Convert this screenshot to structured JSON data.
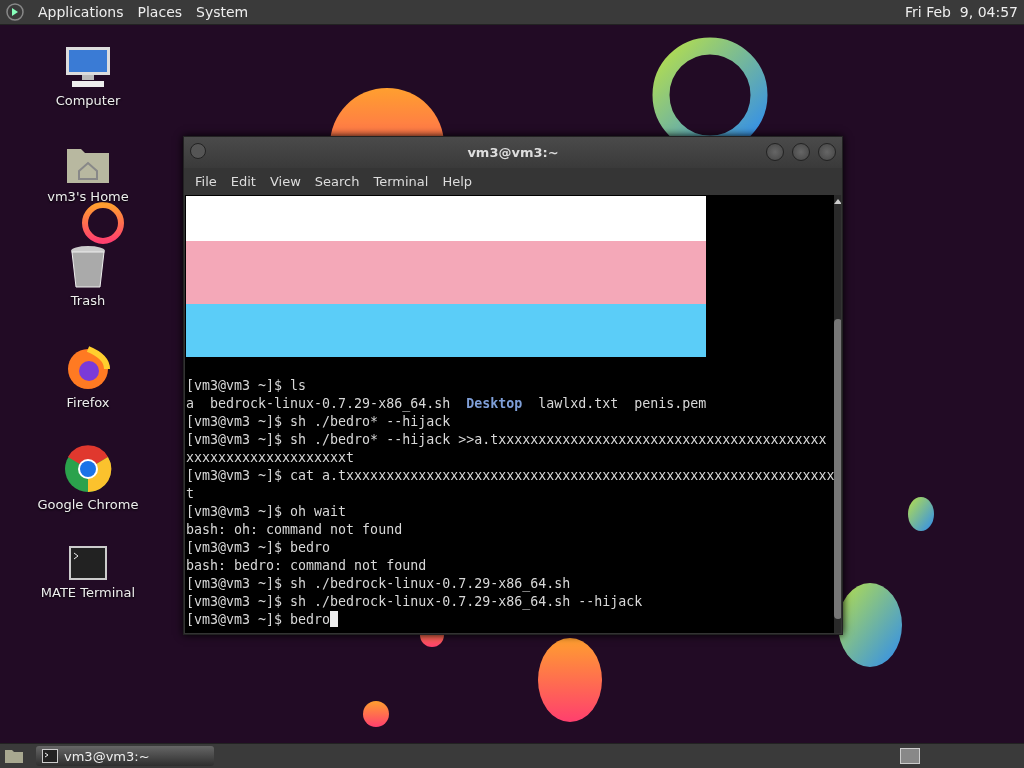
{
  "top_panel": {
    "menus": [
      {
        "label": "Applications"
      },
      {
        "label": "Places"
      },
      {
        "label": "System"
      }
    ],
    "clock": "Fri Feb  9, 04:57"
  },
  "desktop_icons": [
    {
      "label": "Computer",
      "kind": "computer"
    },
    {
      "label": "vm3's Home",
      "kind": "home"
    },
    {
      "label": "Trash",
      "kind": "trash"
    },
    {
      "label": "Firefox",
      "kind": "firefox"
    },
    {
      "label": "Google Chrome",
      "kind": "chrome"
    },
    {
      "label": "MATE Terminal",
      "kind": "terminal"
    }
  ],
  "window": {
    "title": "vm3@vm3:~",
    "menus": [
      {
        "label": "File"
      },
      {
        "label": "Edit"
      },
      {
        "label": "View"
      },
      {
        "label": "Search"
      },
      {
        "label": "Terminal"
      },
      {
        "label": "Help"
      }
    ],
    "lines": [
      "[vm3@vm3 ~]$ ls",
      "a  bedrock-linux-0.7.29-x86_64.sh  **Desktop**  lawlxd.txt  penis.pem",
      "[vm3@vm3 ~]$ sh ./bedro* --hijack",
      "[vm3@vm3 ~]$ sh ./bedro* --hijack >>a.txxxxxxxxxxxxxxxxxxxxxxxxxxxxxxxxxxxxxxxxx",
      "xxxxxxxxxxxxxxxxxxxxt",
      "[vm3@vm3 ~]$ cat a.txxxxxxxxxxxxxxxxxxxxxxxxxxxxxxxxxxxxxxxxxxxxxxxxxxxxxxxxxxxxx",
      "t",
      "[vm3@vm3 ~]$ oh wait",
      "bash: oh: command not found",
      "[vm3@vm3 ~]$ bedro",
      "bash: bedro: command not found",
      "[vm3@vm3 ~]$ sh ./bedrock-linux-0.7.29-x86_64.sh",
      "[vm3@vm3 ~]$ sh ./bedrock-linux-0.7.29-x86_64.sh --hijack",
      "[vm3@vm3 ~]$ bedro"
    ]
  },
  "taskbar": {
    "tasks": [
      {
        "label": "vm3@vm3:~",
        "selected": true
      }
    ]
  }
}
